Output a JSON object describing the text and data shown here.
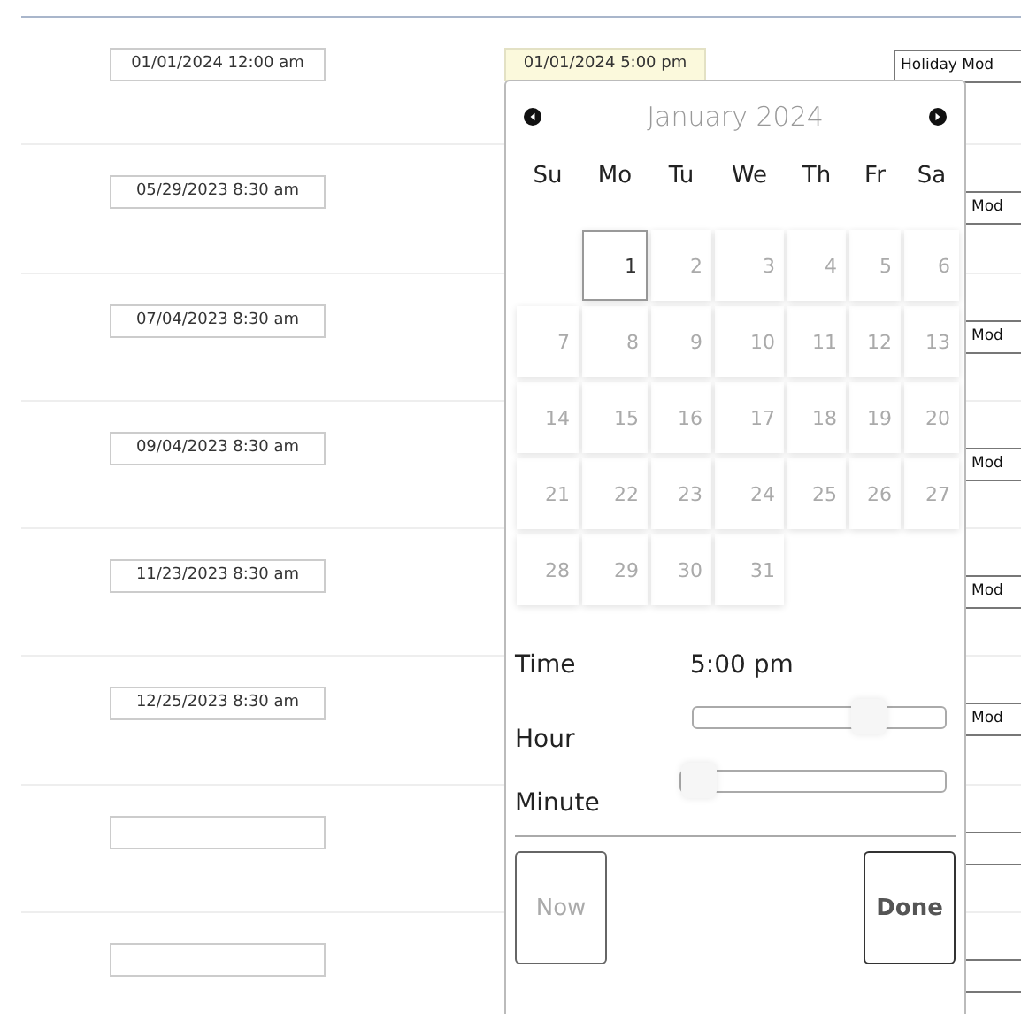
{
  "rows": [
    {
      "start": "01/01/2024 12:00 am",
      "end": "01/01/2024 5:00 pm",
      "mode": "Holiday Mod"
    },
    {
      "start": "05/29/2023 8:30 am",
      "mode": "Mod"
    },
    {
      "start": "07/04/2023 8:30 am",
      "mode": "Mod"
    },
    {
      "start": "09/04/2023 8:30 am",
      "mode": "Mod"
    },
    {
      "start": "11/23/2023 8:30 am",
      "mode": "Mod"
    },
    {
      "start": "12/25/2023 8:30 am",
      "mode": "Mod"
    },
    {},
    {}
  ],
  "picker": {
    "title": "January 2024",
    "weekdays": [
      "Su",
      "Mo",
      "Tu",
      "We",
      "Th",
      "Fr",
      "Sa"
    ],
    "weeks": [
      {
        "kind": "leading",
        "days": [
          {
            "label": "1",
            "selected": true
          },
          {
            "label": "2",
            "selected": false
          },
          {
            "label": "3",
            "selected": false
          },
          {
            "label": "4",
            "selected": false
          },
          {
            "label": "5",
            "selected": false
          },
          {
            "label": "6",
            "selected": false
          }
        ]
      },
      {
        "kind": "full",
        "days": [
          {
            "label": "7",
            "selected": false
          },
          {
            "label": "8",
            "selected": false
          },
          {
            "label": "9",
            "selected": false
          },
          {
            "label": "10",
            "selected": false
          },
          {
            "label": "11",
            "selected": false
          },
          {
            "label": "12",
            "selected": false
          },
          {
            "label": "13",
            "selected": false
          }
        ]
      },
      {
        "kind": "full",
        "days": [
          {
            "label": "14",
            "selected": false
          },
          {
            "label": "15",
            "selected": false
          },
          {
            "label": "16",
            "selected": false
          },
          {
            "label": "17",
            "selected": false
          },
          {
            "label": "18",
            "selected": false
          },
          {
            "label": "19",
            "selected": false
          },
          {
            "label": "20",
            "selected": false
          }
        ]
      },
      {
        "kind": "full",
        "days": [
          {
            "label": "21",
            "selected": false
          },
          {
            "label": "22",
            "selected": false
          },
          {
            "label": "23",
            "selected": false
          },
          {
            "label": "24",
            "selected": false
          },
          {
            "label": "25",
            "selected": false
          },
          {
            "label": "26",
            "selected": false
          },
          {
            "label": "27",
            "selected": false
          }
        ]
      },
      {
        "kind": "trailing",
        "days": [
          {
            "label": "28",
            "selected": false
          },
          {
            "label": "29",
            "selected": false
          },
          {
            "label": "30",
            "selected": false
          },
          {
            "label": "31",
            "selected": false
          }
        ]
      }
    ],
    "time_label": "Time",
    "time_value": "5:00 pm",
    "sliders": [
      {
        "label": "Hour",
        "level": 0.74
      },
      {
        "label": "Minute",
        "level": 0
      }
    ],
    "buttons": [
      {
        "label": "Now",
        "disabled": true
      },
      {
        "label": "Done",
        "disabled": false
      }
    ]
  }
}
